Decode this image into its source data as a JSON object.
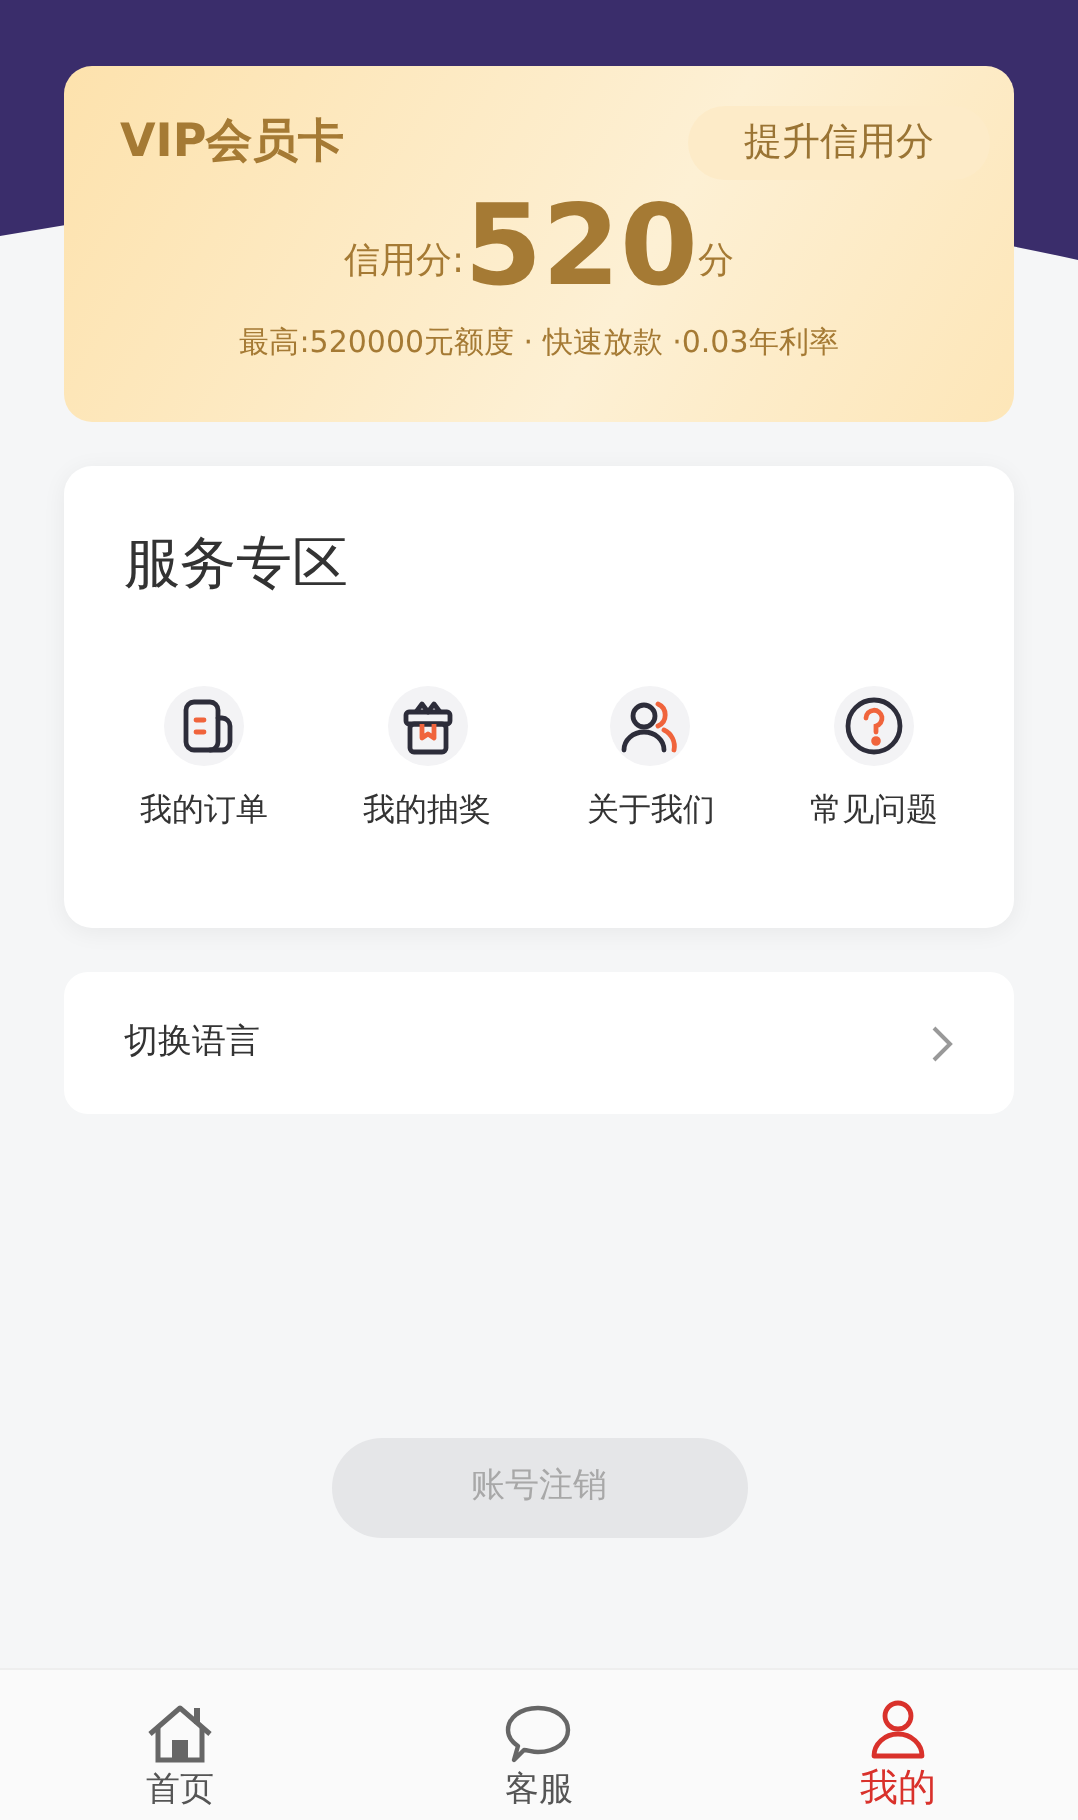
{
  "vip_card": {
    "title": "VIP会员卡",
    "action": "提升信用分",
    "score_label": "信用分:",
    "score": "520",
    "score_unit": "分",
    "perks": "最高:520000元额度 · 快速放款 ·0.03年利率"
  },
  "services": {
    "title": "服务专区",
    "items": [
      {
        "kind": "orders",
        "label": "我的订单"
      },
      {
        "kind": "lottery",
        "label": "我的抽奖"
      },
      {
        "kind": "about",
        "label": "关于我们"
      },
      {
        "kind": "faq",
        "label": "常见问题"
      }
    ]
  },
  "settings": [
    {
      "label": "切换语言"
    }
  ],
  "cancel_button": {
    "label": "账号注销",
    "disabled": true
  },
  "tabs": [
    {
      "kind": "home",
      "label": "首页",
      "selected": false
    },
    {
      "kind": "chat",
      "label": "客服",
      "selected": false
    },
    {
      "kind": "profile",
      "label": "我的",
      "selected": true
    }
  ]
}
